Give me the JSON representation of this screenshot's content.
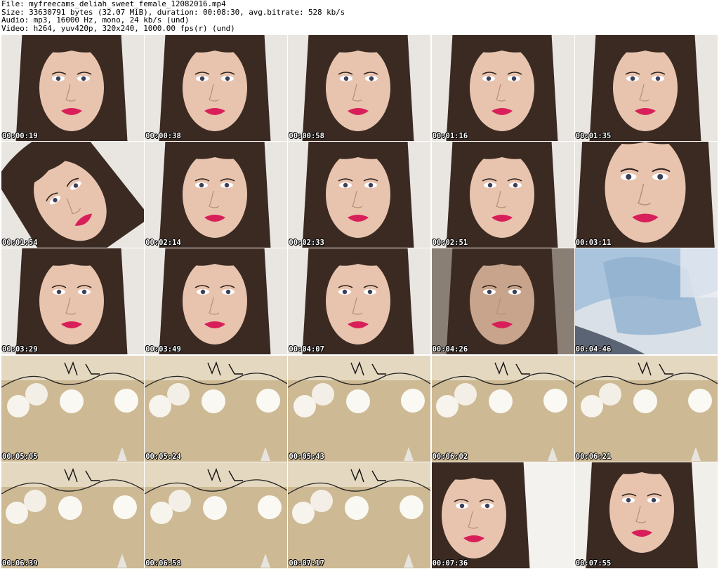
{
  "header": {
    "file": "File: myfreecams_deliah_sweet_female_12082016.mp4",
    "size": "Size: 33630791 bytes (32.07 MiB), duration: 00:08:30, avg.bitrate: 528 kb/s",
    "audio": "Audio: mp3, 16000 Hz, mono, 24 kb/s (und)",
    "video": "Video: h264, yuv420p, 320x240, 1000.00 fps(r) (und)"
  },
  "thumbnails": [
    {
      "timestamp": "00:00:19",
      "scene": "face"
    },
    {
      "timestamp": "00:00:38",
      "scene": "face"
    },
    {
      "timestamp": "00:00:58",
      "scene": "face"
    },
    {
      "timestamp": "00:01:16",
      "scene": "face"
    },
    {
      "timestamp": "00:01:35",
      "scene": "face"
    },
    {
      "timestamp": "00:01:54",
      "scene": "face-tilted"
    },
    {
      "timestamp": "00:02:14",
      "scene": "face"
    },
    {
      "timestamp": "00:02:33",
      "scene": "face"
    },
    {
      "timestamp": "00:02:51",
      "scene": "face"
    },
    {
      "timestamp": "00:03:11",
      "scene": "face-close"
    },
    {
      "timestamp": "00:03:29",
      "scene": "face"
    },
    {
      "timestamp": "00:03:49",
      "scene": "face"
    },
    {
      "timestamp": "00:04:07",
      "scene": "face-hand"
    },
    {
      "timestamp": "00:04:26",
      "scene": "face-dark"
    },
    {
      "timestamp": "00:04:46",
      "scene": "blur"
    },
    {
      "timestamp": "00:05:05",
      "scene": "lights"
    },
    {
      "timestamp": "00:05:24",
      "scene": "lights"
    },
    {
      "timestamp": "00:05:43",
      "scene": "lights"
    },
    {
      "timestamp": "00:06:02",
      "scene": "lights"
    },
    {
      "timestamp": "00:06:21",
      "scene": "lights"
    },
    {
      "timestamp": "00:06:39",
      "scene": "lights"
    },
    {
      "timestamp": "00:06:58",
      "scene": "lights"
    },
    {
      "timestamp": "00:07:17",
      "scene": "lights"
    },
    {
      "timestamp": "00:07:36",
      "scene": "face-side"
    },
    {
      "timestamp": "00:07:55",
      "scene": "face-side2"
    }
  ],
  "colors": {
    "background": "#ffffff",
    "hair": "#3a2a22",
    "skin": "#e8c4ae",
    "lips": "#d81f5a",
    "wall": "#e9e6e2",
    "lights_wall": "#c8b48e"
  }
}
